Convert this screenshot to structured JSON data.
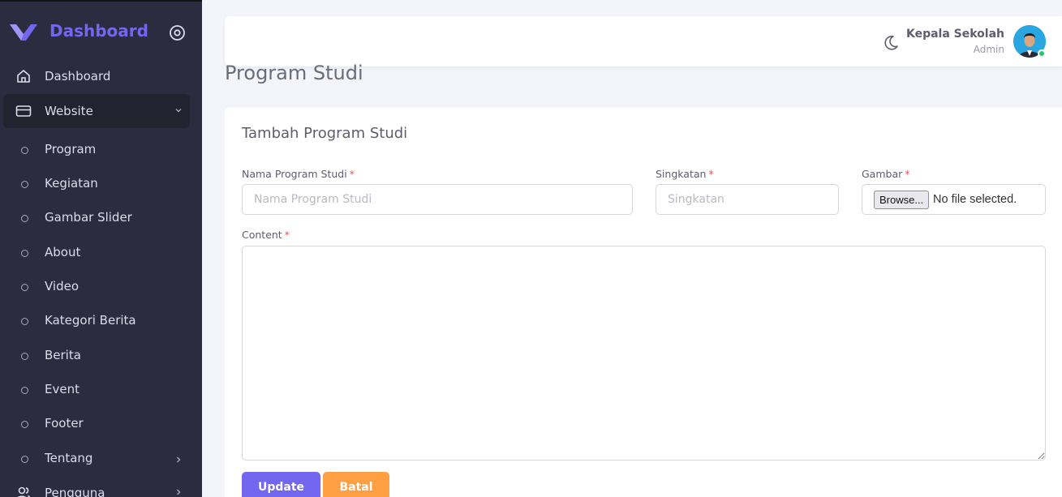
{
  "brand": {
    "name": "Dashboard",
    "accent": "#7367f0"
  },
  "sidebar": {
    "dashboard_label": "Dashboard",
    "website_label": "Website",
    "sub_items": [
      "Program",
      "Kegiatan",
      "Gambar Slider",
      "About",
      "Video",
      "Kategori Berita",
      "Berita",
      "Event",
      "Footer",
      "Tentang"
    ],
    "pengguna_label": "Pengguna"
  },
  "topbar": {
    "user_name": "Kepala Sekolah",
    "user_role": "Admin",
    "status_color": "#28c76f"
  },
  "page": {
    "title": "Program Studi"
  },
  "form": {
    "card_title": "Tambah Program Studi",
    "nama": {
      "label": "Nama Program Studi",
      "required": "*",
      "placeholder": "Nama Program Studi"
    },
    "singkatan": {
      "label": "Singkatan",
      "required": "*",
      "placeholder": "Singkatan"
    },
    "gambar": {
      "label": "Gambar",
      "required": "*",
      "browse_label": "Browse...",
      "no_file": "No file selected."
    },
    "content": {
      "label": "Content",
      "required": "*"
    },
    "update_label": "Update",
    "batal_label": "Batal"
  }
}
